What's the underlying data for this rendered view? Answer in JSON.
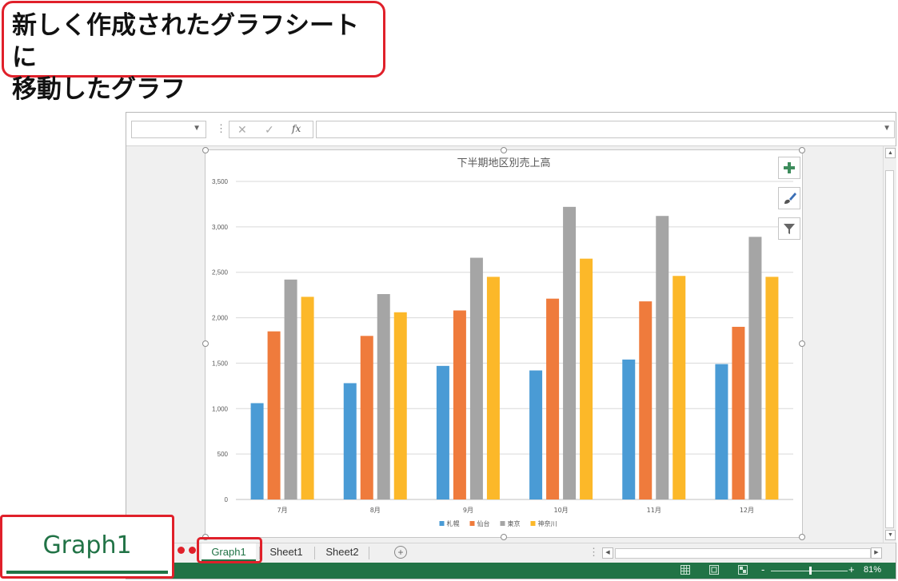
{
  "callout": {
    "line1": "新しく作成されたグラフシートに",
    "line2": "移動したグラフ"
  },
  "formula_bar": {
    "cancel_icon": "✕",
    "enter_icon": "✓",
    "fx_label": "fx"
  },
  "chart_tools": [
    "plus-icon",
    "brush-icon",
    "filter-icon"
  ],
  "chart_data": {
    "type": "bar",
    "title": "下半期地区別売上高",
    "categories": [
      "7月",
      "8月",
      "9月",
      "10月",
      "11月",
      "12月"
    ],
    "series": [
      {
        "name": "札幌",
        "color": "#4a9bd5",
        "values": [
          1060,
          1280,
          1470,
          1420,
          1540,
          1490
        ]
      },
      {
        "name": "仙台",
        "color": "#ef7b3c",
        "values": [
          1850,
          1800,
          2080,
          2210,
          2180,
          1900
        ]
      },
      {
        "name": "東京",
        "color": "#a5a5a5",
        "values": [
          2420,
          2260,
          2660,
          3220,
          3120,
          2890
        ]
      },
      {
        "name": "神奈川",
        "color": "#fcb829",
        "values": [
          2230,
          2060,
          2450,
          2650,
          2460,
          2450
        ]
      }
    ],
    "ylim": [
      0,
      3500
    ],
    "yticks": [
      "0",
      "500",
      "1,000",
      "1,500",
      "2,000",
      "2,500",
      "3,000",
      "3,500"
    ],
    "grid": true,
    "legend_position": "bottom"
  },
  "sheet_tabs": [
    {
      "label": "Graph1",
      "active": true
    },
    {
      "label": "Sheet1",
      "active": false
    },
    {
      "label": "Sheet2",
      "active": false
    }
  ],
  "add_sheet_icon": "+",
  "status_bar": {
    "zoom_level": "81%",
    "zoom_minus": "-",
    "zoom_plus": "+",
    "view_icons": [
      "normal-view-icon",
      "page-layout-view-icon",
      "page-break-view-icon"
    ]
  },
  "tab_zoom_callout": {
    "label": "Graph1"
  }
}
